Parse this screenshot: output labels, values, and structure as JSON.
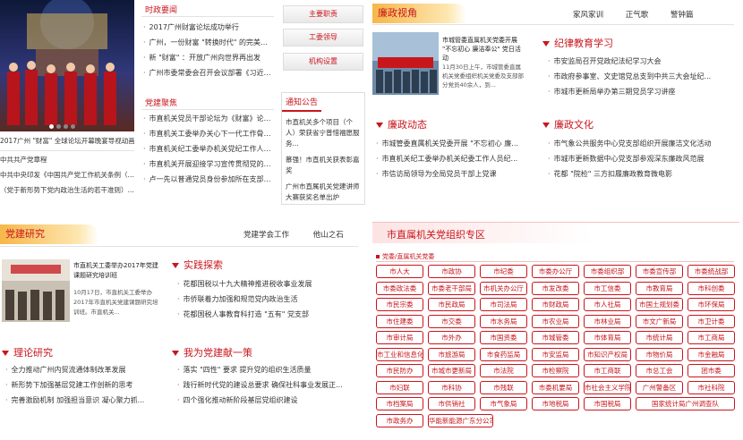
{
  "top_left": {
    "carousel_caption": "2017广州 \"财富\" 全球论坛开幕晚宴导视动画",
    "dots": 4,
    "tabs": [
      "时政要闻",
      "党建聚焦"
    ],
    "news": [
      "2017广州财富论坛成功举行",
      "广州，一份财富 \"转换时代\" 的完美答卷",
      "新 \"财富\" ：开放广州向世界再出发",
      "广州市委常委会召开会议部署《习近平谈治国理..."
    ],
    "party_news": [
      "市直机关党员干部论坛为《财富》论坛打CALL!",
      "市直机关工委举办关心下一代工作骨干培训班",
      "市直机关纪工委举办机关党纪工作人员纪检业务...",
      "市直机关开展迎接学习宣传贯彻党的十九大精神...",
      "卢一先以普通党员身份参加所在支部组织生活会"
    ],
    "side_links": [
      "中共共产党章程",
      "中共中央印发《中国共产党工作机关条例（试行）》",
      "（党于新形势下党内政治生活的若干准则）全文"
    ]
  },
  "right_buttons": [
    "主要职责",
    "工委领导",
    "机构设置"
  ],
  "notice": {
    "title": "通知公告",
    "items": [
      "市直机关多个项目（个人）荣获省宁普惜福愿服务...",
      "慕强！市直机关获表彰嘉奖",
      "广州市直属机关党建讲师大赛获奖名单出炉"
    ]
  },
  "lianzheng": {
    "title": "廉政视角",
    "tabs": [
      "家风家训",
      "正气歌",
      "警钟篇"
    ],
    "photo_caption": "市城管委直属机关党委开展 \"不忘初心 廉洁奉公\" 党日活动",
    "photo_text": "11月30日上午，市城管委直属机关党委组织机关党委及支部部分党员40余人，到...",
    "sections": [
      {
        "title": "纪律教育学习",
        "items": [
          "市安监局召开党政纪法纪学习大会",
          "市政府参事室、文史馆党总支到中共三大会址纪...",
          "市城市更新局举办第三期党员学习讲座"
        ]
      },
      {
        "title": "廉政动态",
        "items": [
          "市城管委直属机关党委开展 \"不忘初心 廉...",
          "市直机关纪工委举办机关纪委工作人员纪...",
          "市信访局领导为全局党员干部上党课"
        ]
      },
      {
        "title": "廉政文化",
        "items": [
          "市气象公共服务中心党支部组织开展廉洁文化活动",
          "市城市更新数据中心党支部参观深东廉政风范展",
          "花都 \"院检\" 三方扣履廉政教育微电影"
        ]
      }
    ]
  },
  "dangjian": {
    "title": "党建研究",
    "tabs": [
      "党建学会工作",
      "他山之石"
    ],
    "photo_caption": "市直机关工委举办2017年党建课题研究培训班",
    "photo_text": "10月17日，市直机关工委举办2017年市直机关党建课题研究培训班。市直机关...",
    "sections": [
      {
        "title": "实践探索",
        "items": [
          "花都国税以十九大精神推进税收事业发展",
          "市侨联着力加强和规范党内政治生活",
          "花都国税人事教育科打造 \"五有\" 党支部"
        ]
      },
      {
        "title": "理论研究",
        "items": [
          "全力推动广州内贸流通体制改革发展",
          "新形势下加强基层党建工作创新的思考",
          "完善激励机制 加强担当意识 凝心聚力抓..."
        ]
      },
      {
        "title": "我为党建献一策",
        "items": [
          "落实 \"四性\" 要求 提升党的组织生活质量",
          "践行新时代党的建设总要求 确保社科事业发展正...",
          "四个强化推动新阶段基层党组织建设"
        ]
      }
    ]
  },
  "zhuanqu": {
    "title": "市直属机关党组织专区",
    "breadcrumb": "党委/直属机关党委",
    "rows": [
      [
        "市人大",
        "市政协",
        "市纪委",
        "市委办公厅",
        "市委组织部",
        "市委宣传部",
        "市委统战部"
      ],
      [
        "市委政法委",
        "市委老干部局",
        "市机关办公厅",
        "市发改委",
        "市工信委",
        "市教育局",
        "市科创委"
      ],
      [
        "市民宗委",
        "市民政局",
        "市司法局",
        "市财政局",
        "市人社局",
        "市国土规划委",
        "市环保局"
      ],
      [
        "市住建委",
        "市交委",
        "市水务局",
        "市农业局",
        "市林业局",
        "市文广新局",
        "市卫计委"
      ],
      [
        "市审计局",
        "市外办",
        "市国资委",
        "市城管委",
        "市体育局",
        "市统计局",
        "市工商局"
      ],
      [
        "市工业和信息化",
        "市旅游局",
        "市食药监局",
        "市安监局",
        "市知识产权局",
        "市物价局",
        "市金融局"
      ],
      [
        "市民防办",
        "市城市更新局",
        "市法院",
        "市检察院",
        "市工商联",
        "市总工会",
        "团市委"
      ],
      [
        "市妇联",
        "市科协",
        "市残联",
        "市委机要局",
        "市社会主义学院",
        "广州警备区",
        "市社科院"
      ],
      [
        "市档案局",
        "市供销社",
        "市气象局",
        "市地税局",
        "市国税局",
        "国家统计局广州调查队",
        ""
      ],
      [
        "市政务办",
        "华能新能源广东分公司",
        "",
        "",
        "",
        "",
        ""
      ]
    ]
  }
}
